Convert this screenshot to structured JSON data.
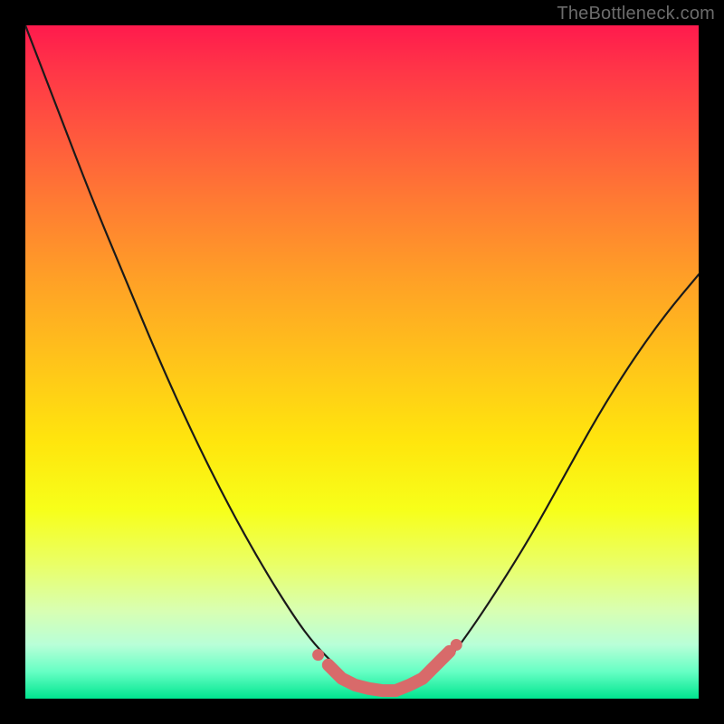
{
  "watermark": {
    "text": "TheBottleneck.com"
  },
  "colors": {
    "frame": "#000000",
    "curve": "#1a1a1a",
    "marker": "#d86a6a",
    "gradient_top": "#ff1a4d",
    "gradient_mid": "#ffe60d",
    "gradient_bottom": "#00e58f"
  },
  "chart_data": {
    "type": "line",
    "title": "",
    "xlabel": "",
    "ylabel": "",
    "xlim": [
      0,
      100
    ],
    "ylim": [
      0,
      100
    ],
    "grid": false,
    "legend": false,
    "x": [
      0,
      5,
      10,
      15,
      20,
      25,
      30,
      35,
      40,
      43,
      46,
      48,
      50,
      52,
      54,
      56,
      58,
      60,
      63,
      66,
      70,
      75,
      80,
      85,
      90,
      95,
      100
    ],
    "y": [
      100,
      87,
      74,
      62,
      50,
      39,
      29,
      20,
      12,
      8,
      5,
      3,
      2,
      1.2,
      1,
      1,
      1.5,
      3,
      6,
      10,
      16,
      24,
      33,
      42,
      50,
      57,
      63
    ],
    "markers": {
      "x": [
        45,
        47,
        49,
        51,
        53,
        55,
        57,
        59,
        61,
        63
      ],
      "y": [
        5,
        3,
        2,
        1.5,
        1.2,
        1.2,
        2,
        3,
        5,
        7
      ]
    },
    "annotations": []
  }
}
